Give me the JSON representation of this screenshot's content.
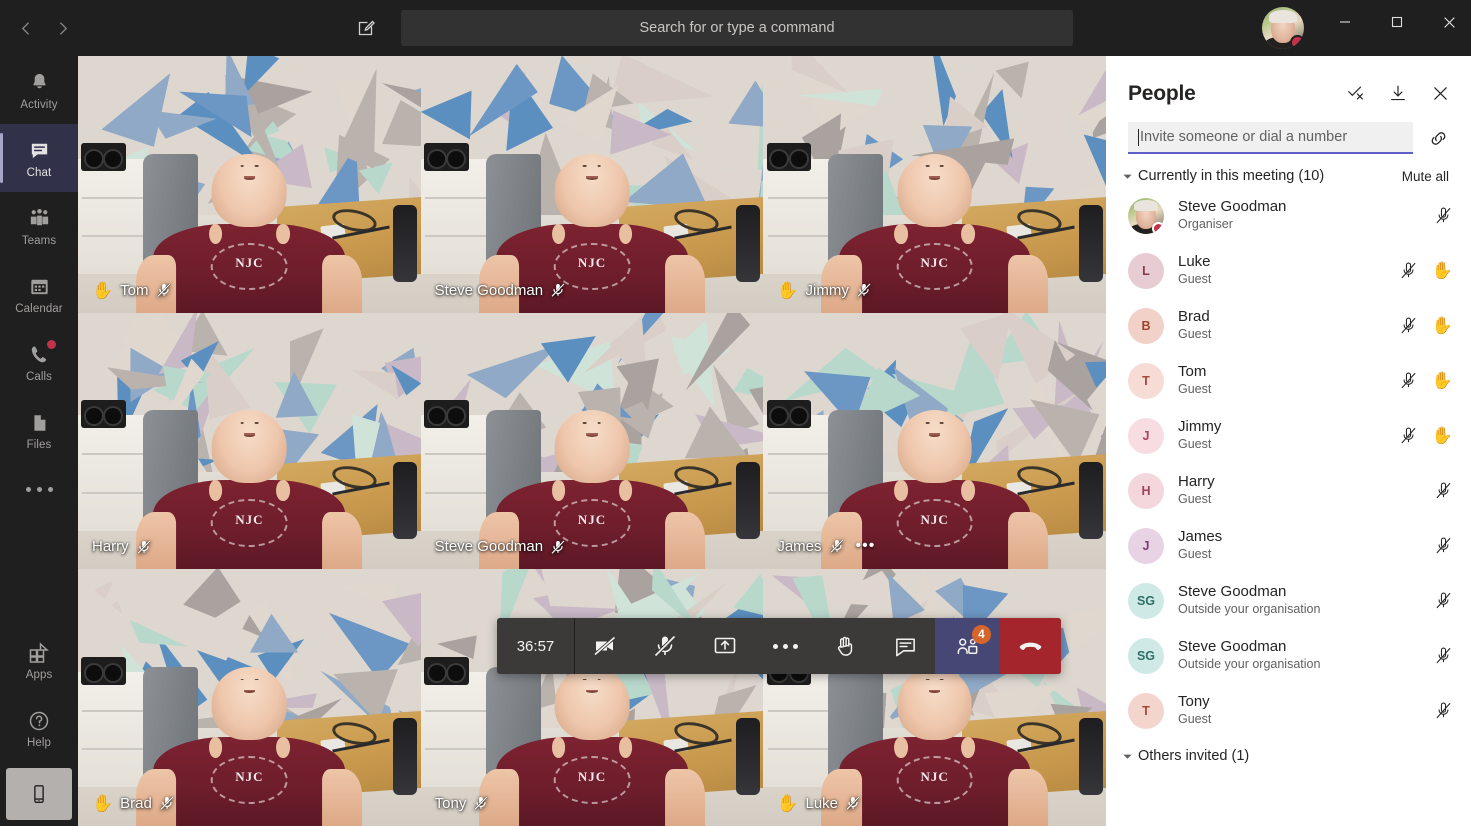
{
  "titlebar": {
    "back_icon": "chevron-left-icon",
    "forward_icon": "chevron-right-icon",
    "compose_icon": "compose-new-chat-icon",
    "search_placeholder": "Search for or type a command",
    "minimize_label": "Minimize",
    "maximize_label": "Maximize",
    "close_label": "Close"
  },
  "rail": {
    "items": [
      {
        "label": "Activity",
        "icon": "bell-icon",
        "active": false,
        "badge": false
      },
      {
        "label": "Chat",
        "icon": "chat-bubble-icon",
        "active": true,
        "badge": false
      },
      {
        "label": "Teams",
        "icon": "teams-people-icon",
        "active": false,
        "badge": false
      },
      {
        "label": "Calendar",
        "icon": "calendar-icon",
        "active": false,
        "badge": false
      },
      {
        "label": "Calls",
        "icon": "phone-icon",
        "active": false,
        "badge": true
      },
      {
        "label": "Files",
        "icon": "file-icon",
        "active": false,
        "badge": false
      }
    ],
    "more_icon": "more-apps-icon",
    "apps_label": "Apps",
    "apps_icon": "apps-grid-icon",
    "help_label": "Help",
    "help_icon": "question-circle-icon",
    "device_icon": "mobile-device-icon"
  },
  "stage": {
    "tiles": [
      {
        "name": "Tom",
        "hand_raised": true,
        "muted": true,
        "overflow": false
      },
      {
        "name": "Steve Goodman",
        "hand_raised": false,
        "muted": true,
        "overflow": false
      },
      {
        "name": "Jimmy",
        "hand_raised": true,
        "muted": true,
        "overflow": false
      },
      {
        "name": "Harry",
        "hand_raised": false,
        "muted": true,
        "overflow": false
      },
      {
        "name": "Steve Goodman",
        "hand_raised": false,
        "muted": true,
        "overflow": false
      },
      {
        "name": "James",
        "hand_raised": false,
        "muted": true,
        "overflow": true
      },
      {
        "name": "Brad",
        "hand_raised": true,
        "muted": true,
        "overflow": false
      },
      {
        "name": "Tony",
        "hand_raised": false,
        "muted": true,
        "overflow": false
      },
      {
        "name": "Luke",
        "hand_raised": true,
        "muted": true,
        "overflow": false
      }
    ],
    "hand_glyph": "✋"
  },
  "callbar": {
    "timer": "36:57",
    "buttons": [
      {
        "name": "camera-off-button",
        "icon": "camera-off-icon"
      },
      {
        "name": "mic-off-button",
        "icon": "mic-off-icon"
      },
      {
        "name": "share-screen-button",
        "icon": "share-screen-icon"
      },
      {
        "name": "more-actions-button",
        "icon": "ellipsis-icon"
      },
      {
        "name": "raise-hand-button",
        "icon": "raised-hand-icon"
      },
      {
        "name": "chat-button",
        "icon": "chat-bubble-icon"
      }
    ],
    "people_button": {
      "icon": "people-icon",
      "badge": "4",
      "badge_color": "#d7642a",
      "bg_color": "#464775"
    },
    "hangup_button": {
      "icon": "hangup-phone-icon",
      "bg_color": "#a4262c"
    }
  },
  "panel": {
    "title": "People",
    "actions": [
      {
        "name": "mark-all-read-button",
        "icon": "check-x-icon"
      },
      {
        "name": "download-attendance-button",
        "icon": "download-icon"
      },
      {
        "name": "close-panel-button",
        "icon": "close-icon"
      }
    ],
    "invite_placeholder": "Invite someone or dial a number",
    "invite_value": "",
    "copy_link_icon": "copy-link-icon",
    "accent_color": "#5b5fc7",
    "sections": [
      {
        "label": "Currently in this meeting (10)",
        "action_label": "Mute all",
        "expanded": true
      },
      {
        "label": "Others invited (1)",
        "action_label": "",
        "expanded": true
      }
    ],
    "participants": [
      {
        "name": "Steve Goodman",
        "role": "Organiser",
        "initials": "",
        "photo": true,
        "presence": "busy",
        "avatar_bg": "",
        "avatar_fg": "",
        "muted": true,
        "hand_raised": false
      },
      {
        "name": "Luke",
        "role": "Guest",
        "initials": "L",
        "photo": false,
        "presence": "",
        "avatar_bg": "#e8ccd4",
        "avatar_fg": "#8a3a49",
        "muted": true,
        "hand_raised": true
      },
      {
        "name": "Brad",
        "role": "Guest",
        "initials": "B",
        "photo": false,
        "presence": "",
        "avatar_bg": "#f2d2c8",
        "avatar_fg": "#9c4430",
        "muted": true,
        "hand_raised": true
      },
      {
        "name": "Tom",
        "role": "Guest",
        "initials": "T",
        "photo": false,
        "presence": "",
        "avatar_bg": "#f7dcd6",
        "avatar_fg": "#a8483c",
        "muted": true,
        "hand_raised": true
      },
      {
        "name": "Jimmy",
        "role": "Guest",
        "initials": "J",
        "photo": false,
        "presence": "",
        "avatar_bg": "#f7dde2",
        "avatar_fg": "#a8445c",
        "muted": true,
        "hand_raised": true
      },
      {
        "name": "Harry",
        "role": "Guest",
        "initials": "H",
        "photo": false,
        "presence": "",
        "avatar_bg": "#f3d7dd",
        "avatar_fg": "#9e4359",
        "muted": true,
        "hand_raised": false
      },
      {
        "name": "James",
        "role": "Guest",
        "initials": "J",
        "photo": false,
        "presence": "",
        "avatar_bg": "#e7d3e4",
        "avatar_fg": "#7c3f74",
        "muted": true,
        "hand_raised": false
      },
      {
        "name": "Steve Goodman",
        "role": "Outside your organisation",
        "initials": "SG",
        "photo": false,
        "presence": "",
        "avatar_bg": "#cfe9e6",
        "avatar_fg": "#2f6f68",
        "muted": true,
        "hand_raised": false
      },
      {
        "name": "Steve Goodman",
        "role": "Outside your organisation",
        "initials": "SG",
        "photo": false,
        "presence": "",
        "avatar_bg": "#cfe9e6",
        "avatar_fg": "#2f6f68",
        "muted": true,
        "hand_raised": false
      },
      {
        "name": "Tony",
        "role": "Guest",
        "initials": "T",
        "photo": false,
        "presence": "",
        "avatar_bg": "#f4d5cd",
        "avatar_fg": "#a2493a",
        "muted": true,
        "hand_raised": false
      }
    ]
  }
}
